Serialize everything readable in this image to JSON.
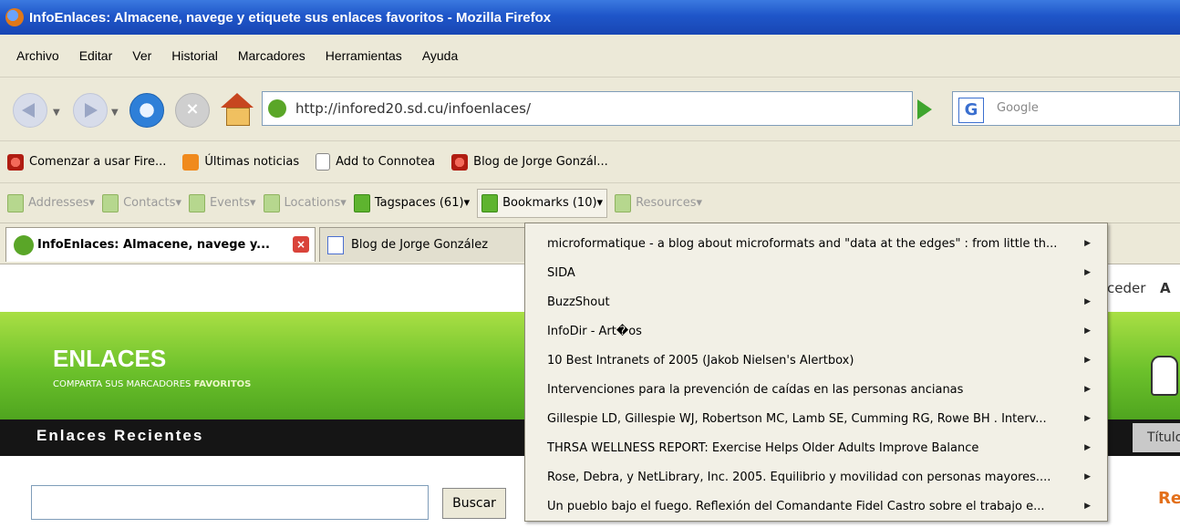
{
  "window": {
    "title": "InfoEnlaces: Almacene, navege y etiquete sus enlaces favoritos - Mozilla Firefox"
  },
  "menubar": [
    "Archivo",
    "Editar",
    "Ver",
    "Historial",
    "Marcadores",
    "Herramientas",
    "Ayuda"
  ],
  "navbar": {
    "url": "http://infored20.sd.cu/infoenlaces/",
    "search_placeholder": "Google"
  },
  "bookmarks": [
    "Comenzar a usar Fire...",
    "Últimas noticias",
    "Add to Connotea",
    "Blog de Jorge Gonzál..."
  ],
  "operator": [
    {
      "label": "Addresses",
      "active": false
    },
    {
      "label": "Contacts",
      "active": false
    },
    {
      "label": "Events",
      "active": false
    },
    {
      "label": "Locations",
      "active": false
    },
    {
      "label": "Tagspaces (61)",
      "active": true
    },
    {
      "label": "Bookmarks (10)",
      "active": true
    },
    {
      "label": "Resources",
      "active": false
    }
  ],
  "tabs": [
    {
      "label": "InfoEnlaces: Almacene, navege y..."
    },
    {
      "label": "Blog de Jorge González"
    }
  ],
  "bookmarks_menu": [
    "microformatique - a blog about microformats and \"data at the edges\" : from little th...",
    "SIDA",
    "BuzzShout",
    "InfoDir - Art�os",
    "10 Best Intranets of 2005 (Jakob Nielsen's Alertbox)",
    "Intervenciones para la prevención de caídas en las personas ancianas",
    "Gillespie LD, Gillespie WJ, Robertson MC, Lamb SE, Cumming RG, Rowe BH . Interv...",
    "THRSA WELLNESS REPORT: Exercise Helps Older Adults Improve Balance",
    "Rose, Debra, y NetLibrary, Inc. 2005. Equilibrio y movilidad con personas mayores....",
    "Un pueblo bajo el fuego. Reflexión del Comandante Fidel Castro sobre el trabajo e..."
  ],
  "page": {
    "partial_link_1": "ceder",
    "partial_link_2": "A",
    "logo_title": "ENLACES",
    "logo_sub_1": "COMPARTA SUS MARCADORES ",
    "logo_sub_2": "FAVORITOS",
    "section_title": "Enlaces Recientes",
    "title_tab": "Título",
    "search_button": "Buscar",
    "right_partial": "Re"
  },
  "colors": {
    "brand_green": "#6cc12b",
    "dark_bar": "#151515",
    "accent_orange": "#e3701b"
  }
}
